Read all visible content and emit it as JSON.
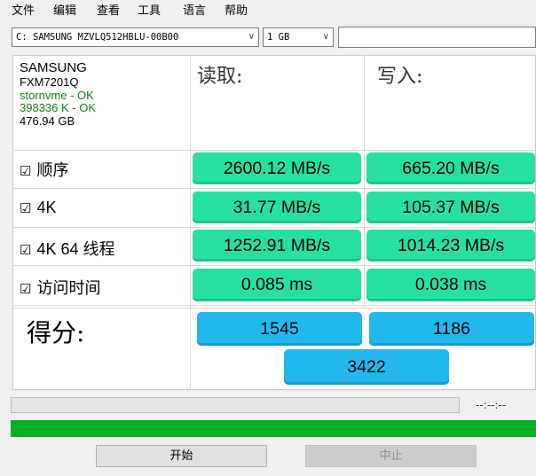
{
  "menu": [
    "文件",
    "编辑",
    "查看",
    "工具",
    "语言",
    "帮助"
  ],
  "toolbar": {
    "drive_select": "C: SAMSUNG MZVLQ512HBLU-00B00",
    "size_select": "1 GB",
    "text_value": ""
  },
  "drive_info": {
    "vendor": "SAMSUNG",
    "firmware": "FXM7201Q",
    "driver": "stornvme - OK",
    "alignment": "398336 K - OK",
    "capacity": "476.94 GB"
  },
  "headers": {
    "read": "读取:",
    "write": "写入:"
  },
  "checkbox_glyph": "☑",
  "rows": [
    {
      "label": "顺序",
      "read": "2600.12 MB/s",
      "write": "665.20 MB/s"
    },
    {
      "label": "4K",
      "read": "31.77 MB/s",
      "write": "105.37 MB/s"
    },
    {
      "label": "4K 64 线程",
      "read": "1252.91 MB/s",
      "write": "1014.23 MB/s"
    },
    {
      "label": "访问时间",
      "read": "0.085 ms",
      "write": "0.038 ms"
    }
  ],
  "score": {
    "label": "得分:",
    "read": "1545",
    "write": "1186",
    "total": "3422"
  },
  "status": {
    "time": "--:--:--",
    "progress": 0,
    "overall_progress": 1.0
  },
  "buttons": {
    "start": "开始",
    "abort": "中止"
  },
  "colors": {
    "cell": "#26e0a3",
    "score": "#22b8ee",
    "progress": "#06b025",
    "ok": "#1a7a1a"
  }
}
